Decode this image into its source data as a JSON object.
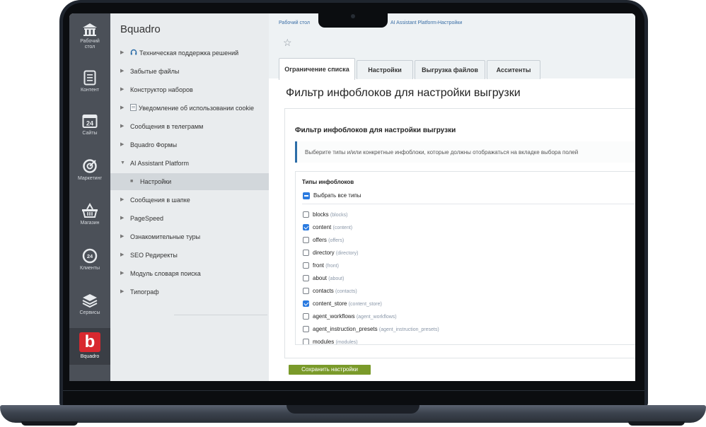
{
  "left_panel": {
    "items": [
      {
        "label": "Рабочий\nстол",
        "icon": "home-icon"
      },
      {
        "label": "Контент",
        "icon": "document-icon"
      },
      {
        "label": "Сайты",
        "icon": "calendar-24-icon"
      },
      {
        "label": "Маркетинг",
        "icon": "target-icon"
      },
      {
        "label": "Магазин",
        "icon": "basket-icon"
      },
      {
        "label": "Клиенты",
        "icon": "clients-24-icon"
      },
      {
        "label": "Сервисы",
        "icon": "layers-icon"
      }
    ],
    "brand": {
      "letter": "b",
      "label": "Bquadro",
      "color": "#d8282f"
    }
  },
  "menu": {
    "title": "Bquadro",
    "items": [
      {
        "label": "Техническая поддержка решений",
        "icon": "headset-icon"
      },
      {
        "label": "Забытые файлы"
      },
      {
        "label": "Конструктор наборов"
      },
      {
        "label": "Уведомление об использовании cookie",
        "icon": "page-icon"
      },
      {
        "label": "Сообщения в телеграмм"
      },
      {
        "label": "Bquadro Формы"
      },
      {
        "label": "AI Assistant Platform",
        "expanded": true
      },
      {
        "label": "Настройки",
        "active": true
      },
      {
        "label": "Сообщения в шапке"
      },
      {
        "label": "PageSpeed"
      },
      {
        "label": "Ознакомительные туры"
      },
      {
        "label": "SEO Редиректы"
      },
      {
        "label": "Модуль словаря поиска"
      },
      {
        "label": "Типограф"
      }
    ]
  },
  "breadcrumb": {
    "part1": "Рабочий стол",
    "part2": "AI Assistant Platform",
    "part3": "Настройки"
  },
  "tabs": [
    {
      "label": "Ограничение списка",
      "active": true
    },
    {
      "label": "Настройки"
    },
    {
      "label": "Выгрузка файлов"
    },
    {
      "label": "Асситенты"
    }
  ],
  "page_title": "Фильтр инфоблоков для настройки выгрузки",
  "card": {
    "title": "Фильтр инфоблоков для настройки выгрузки",
    "notice": "Выберите типы и/или конкретные инфоблоки, которые должны отображаться на вкладке выбора полей",
    "types_label": "Типы инфоблоков",
    "select_all_label": "Выбрать все типы",
    "types": [
      {
        "name": "blocks",
        "code": "(blocks)",
        "checked": false
      },
      {
        "name": "content",
        "code": "(content)",
        "checked": true
      },
      {
        "name": "offers",
        "code": "(offers)",
        "checked": false
      },
      {
        "name": "directory",
        "code": "(directory)",
        "checked": false
      },
      {
        "name": "front",
        "code": "(front)",
        "checked": false
      },
      {
        "name": "about",
        "code": "(about)",
        "checked": false
      },
      {
        "name": "contacts",
        "code": "(contacts)",
        "checked": false
      },
      {
        "name": "content_store",
        "code": "(content_store)",
        "checked": true
      },
      {
        "name": "agent_workflows",
        "code": "(agent_workflows)",
        "checked": false
      },
      {
        "name": "agent_instruction_presets",
        "code": "(agent_instruction_presets)",
        "checked": false
      },
      {
        "name": "modules",
        "code": "(modules)",
        "checked": false
      }
    ]
  },
  "save_label": "Сохранить настройки",
  "colors": {
    "accent_blue": "#2b7be0",
    "save_green": "#7a9a2a",
    "brand_red": "#d8282f"
  }
}
